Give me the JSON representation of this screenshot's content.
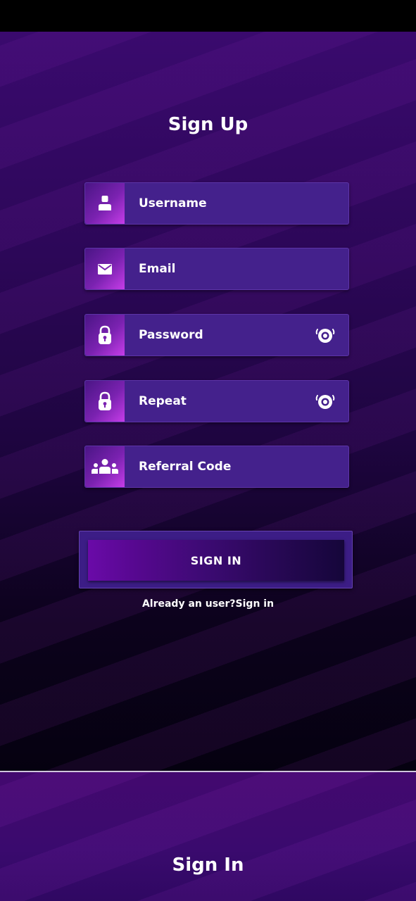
{
  "signup": {
    "title": "Sign Up",
    "fields": [
      {
        "label": "Username",
        "icon": "user-icon"
      },
      {
        "label": "Email",
        "icon": "envelope-icon"
      },
      {
        "label": "Password",
        "icon": "lock-icon",
        "toggle_icon": "eye-icon"
      },
      {
        "label": "Repeat",
        "icon": "lock-icon",
        "toggle_icon": "eye-icon"
      },
      {
        "label": "Referral Code",
        "icon": "group-icon"
      }
    ],
    "submit_label": "SIGN IN",
    "already_user_link": "Already an user?Sign in"
  },
  "signin": {
    "title": "Sign In"
  },
  "colors": {
    "field_bg": "#44218c",
    "icon_box_accent": "#c63de8",
    "button_frame": "#3c1d86"
  }
}
